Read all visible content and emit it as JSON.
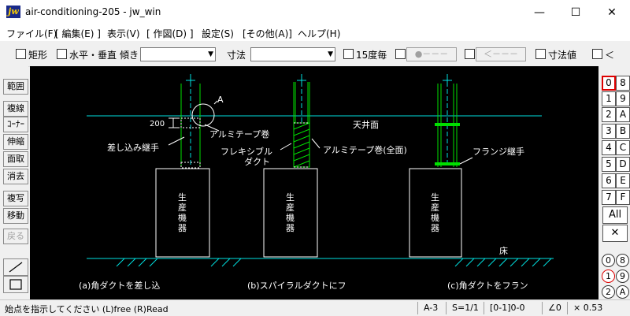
{
  "window": {
    "title": "air-conditioning-205 - jw_win",
    "icon_label": "jw",
    "minimize": "—",
    "maximize": "☐",
    "close": "✕"
  },
  "menu": [
    "ファイル(F)",
    "[ 編集(E) ]",
    "表示(V)",
    "[ 作図(D) ]",
    "設定(S)",
    "[その他(A)]",
    "ヘルプ(H)"
  ],
  "toolbar": {
    "rect": "矩形",
    "horiz_vert": "水平・垂直",
    "tilt": "傾き",
    "dimension": "寸法",
    "deg15": "15度毎",
    "circle_dash": "●－－－",
    "arrow_dash": "＜－－－",
    "dim_value": "寸法値",
    "lt": "＜"
  },
  "left_tools": [
    "範囲",
    "複線",
    "ｺｰﾅｰ",
    "伸縮",
    "面取",
    "消去",
    "複写",
    "移動",
    "戻る"
  ],
  "layers": [
    [
      "0",
      "8"
    ],
    [
      "1",
      "9"
    ],
    [
      "2",
      "A"
    ],
    [
      "3",
      "B"
    ],
    [
      "4",
      "C"
    ],
    [
      "5",
      "D"
    ],
    [
      "6",
      "E"
    ],
    [
      "7",
      "F"
    ]
  ],
  "layer_all": "All",
  "layer_cross": "✕",
  "groups": [
    [
      "0",
      "8"
    ],
    [
      "1",
      "9"
    ],
    [
      "2",
      "A"
    ]
  ],
  "drawing": {
    "label_a": "A",
    "dim_200": "200",
    "ceiling": "天井面",
    "floor": "床",
    "alumi_tape": "アルミテープ巻",
    "flexible": "フレキシブル",
    "duct": "ダクト",
    "insert_joint": "差し込み継手",
    "alumi_full": "アルミテープ巻(全面)",
    "flange_joint": "フランジ継手",
    "equip_char1": "生",
    "equip_char2": "産",
    "equip_char3": "機",
    "equip_char4": "器",
    "caption_a": "(a)角ダクトを差し込",
    "caption_b": "(b)スパイラルダクトにフ",
    "caption_c": "(c)角ダクトをフラン"
  },
  "status": {
    "prompt": "始点を指示してください (L)free (R)Read",
    "paper": "A-3",
    "scale": "S=1/1",
    "layer": "[0-1]0-0",
    "angle": "∠0",
    "zoom": "× 0.53"
  },
  "colors": {
    "cyan": "#00e0e0",
    "green": "#00e000",
    "white": "#ffffff",
    "canvas": "#000000"
  }
}
